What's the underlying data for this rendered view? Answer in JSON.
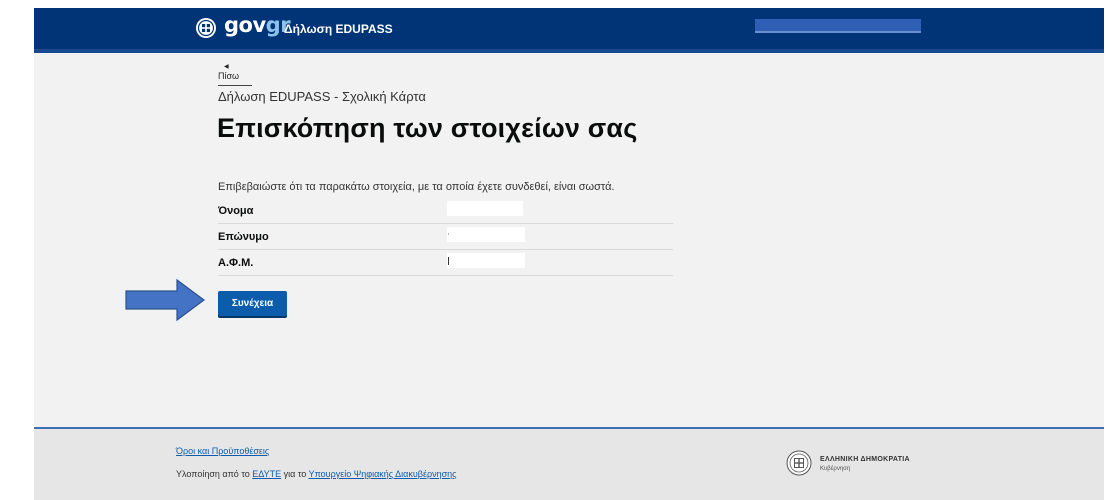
{
  "header": {
    "logo_main": "gov",
    "logo_accent": "gr",
    "title": "Δήλωση EDUPASS",
    "user_name_redacted": ""
  },
  "main": {
    "back_label": "Πίσω",
    "service_name": "Δήλωση EDUPASS - Σχολική Κάρτα",
    "page_title": "Επισκόπηση των στοιχείων σας",
    "intro": "Επιβεβαιώστε ότι τα παρακάτω στοιχεία, με τα οποία έχετε συνδεθεί, είναι σωστά.",
    "fields": [
      {
        "label": "Όνομα",
        "value": ""
      },
      {
        "label": "Επώνυμο",
        "value": ""
      },
      {
        "label": "Α.Φ.Μ.",
        "value": ""
      }
    ],
    "continue_label": "Συνέχεια"
  },
  "footer": {
    "terms_link": "Όροι και Προϋποθέσεις",
    "credit_prefix": "Υλοποίηση από το ",
    "credit_org1": "ΕΔΥΤΕ",
    "credit_middle": " για το ",
    "credit_org2": "Υπουργείο Ψηφιακής Διακυβέρνησης",
    "gov_name": "ΕΛΛΗΝΙΚΗ ΔΗΜΟΚΡΑΤΙΑ",
    "gov_sub": "Κυβέρνηση"
  },
  "colors": {
    "header_bg": "#003476",
    "button_bg": "#0b5cab",
    "annotation_arrow": "#4472c4"
  },
  "icons": {
    "logo": "greek-emblem-icon",
    "back": "chevron-left-icon",
    "annotation": "arrow-right-icon",
    "footer_logo": "greek-emblem-icon"
  }
}
